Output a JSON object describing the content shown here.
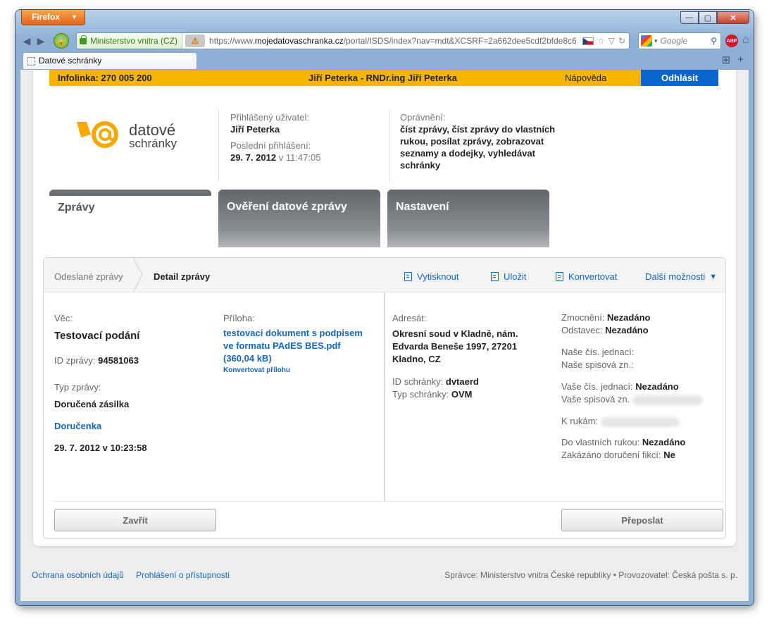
{
  "browser": {
    "app_button": "Firefox",
    "identity_label": "Ministerstvo vnitra (CZ)",
    "url_prefix": "https://www.",
    "url_domain": "mojedatovaschranka.cz",
    "url_path": "/portal/ISDS/index?nav=mdt&XCSRF=2a662dee5cdf2bfde8c6",
    "search_placeholder": "Google",
    "abp_label": "ABP",
    "tab_title": "Datové schránky"
  },
  "topbar": {
    "infoline": "Infolinka: 270 005 200",
    "user": "Jiří Peterka - RNDr.ing Jiří Peterka",
    "help": "Nápověda",
    "logout": "Odhlásit"
  },
  "logo": {
    "line1": "datové",
    "line2": "schránky"
  },
  "account": {
    "user_label": "Přihlášený uživatel:",
    "user_value": "Jiří Peterka",
    "last_login_label": "Poslední přihlášení:",
    "last_login_date": "29. 7. 2012",
    "last_login_sep": "v",
    "last_login_time": "11:47:05",
    "perm_label": "Oprávnění:",
    "perm_value": "číst zprávy, číst zprávy do vlastních rukou, posílat zprávy, zobrazovat seznamy a dodejky, vyhledávat schránky"
  },
  "tabs": [
    "Zprávy",
    "Ověření datové zprávy",
    "Nastavení"
  ],
  "breadcrumb": {
    "parent": "Odeslané zprávy",
    "current": "Detail zprávy"
  },
  "actions": {
    "print": "Vytisknout",
    "save": "Uložit",
    "convert": "Konvertovat",
    "more": "Další možnosti",
    "more_arrow": "▼"
  },
  "message": {
    "subject_label": "Věc:",
    "subject_value": "Testovací podání",
    "id_label": "ID zprávy:",
    "id_value": "94581063",
    "type_label": "Typ zprávy:",
    "type_value": "Doručená zásilka",
    "receipt_link": "Doručenka",
    "datetime": "29. 7. 2012 v 10:23:58",
    "attachment_label": "Příloha:",
    "attachment_link": "testovaci dokument s podpisem ve formatu PAdES BES.pdf (360,04 kB)",
    "convert_attachment": "Konvertovat přílohu"
  },
  "recipient": {
    "label": "Adresát:",
    "value": "Okresní soud v Kladně, nám. Edvarda Beneše 1997, 27201 Kladno, CZ",
    "box_id_label": "ID schránky:",
    "box_id_value": "dvtaerd",
    "box_type_label": "Typ schránky:",
    "box_type_value": "OVM"
  },
  "details": {
    "zmocneni_label": "Zmocnění:",
    "zmocneni_value": "Nezadáno",
    "odstavec_label": "Odstavec:",
    "odstavec_value": "Nezadáno",
    "our_ref_label": "Naše čís. jednací:",
    "our_file_label": "Naše spisová zn.:",
    "your_ref_label": "Vaše čís. jednací:",
    "your_ref_value": "Nezadáno",
    "your_file_label": "Vaše spisová zn.",
    "attention_label": "K rukám:",
    "own_hands_label": "Do vlastních rukou:",
    "own_hands_value": "Nezadáno",
    "fiction_label": "Zakázáno doručení fikcí:",
    "fiction_value": "Ne"
  },
  "buttons": {
    "close": "Zavřít",
    "forward": "Přeposlat"
  },
  "footer": {
    "privacy": "Ochrana osobních údajů",
    "accessibility": "Prohlášení o přístupnosti",
    "operator": "Správce: Ministerstvo vnitra České republiky • Provozovatel: Česká pošta s. p."
  }
}
